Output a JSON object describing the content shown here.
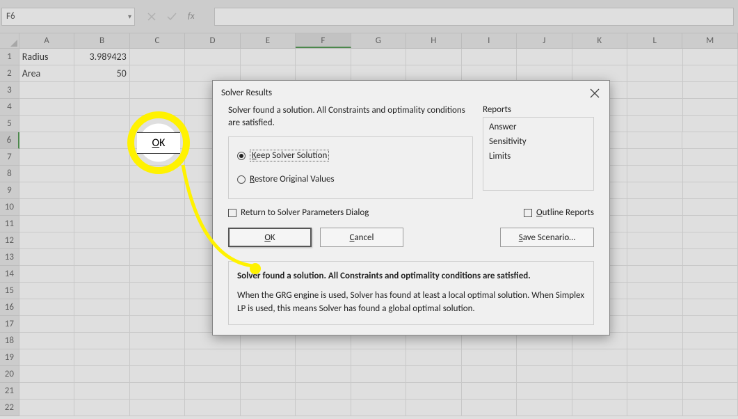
{
  "namebox": {
    "value": "F6"
  },
  "columns": [
    "A",
    "B",
    "C",
    "D",
    "E",
    "F",
    "G",
    "H",
    "I",
    "J",
    "K",
    "L",
    "M"
  ],
  "active_col": "F",
  "rows": 22,
  "active_row": 6,
  "cells": {
    "A1": "Radius",
    "B1": "3.989423",
    "A2": "Area",
    "B2": "50"
  },
  "dialog": {
    "title": "Solver Results",
    "close": "×",
    "found_msg": "Solver found a solution.  All Constraints and optimality conditions are satisfied.",
    "keep": "Keep Solver Solution",
    "keep_accel": "K",
    "restore": "Restore Original Values",
    "restore_accel": "R",
    "reports_label": "Reports",
    "reports": {
      "answer": "Answer",
      "sensitivity": "Sensitivity",
      "limits": "Limits"
    },
    "return_dlg": "Return to Solver Parameters Dialog",
    "outline": "Outline Reports",
    "outline_accel": "O",
    "ok": "OK",
    "ok_accel": "O",
    "cancel": "Cancel",
    "cancel_accel": "C",
    "save_scenario": "Save Scenario…",
    "save_accel": "S",
    "msg_bold": "Solver found a solution.  All Constraints and optimality conditions are satisfied.",
    "msg_detail": "When the GRG engine is used, Solver has found at least a local optimal solution. When Simplex LP is used, this means Solver has found a global optimal solution."
  },
  "highlight": {
    "ok": "OK",
    "ok_accel": "O"
  }
}
